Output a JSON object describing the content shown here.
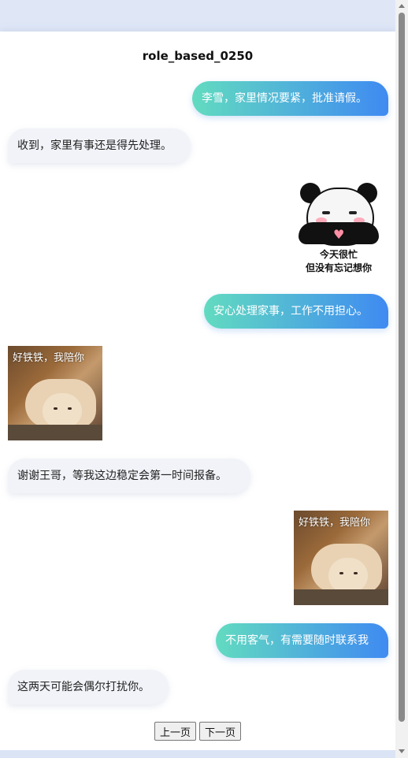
{
  "chat": {
    "title": "role_based_0250",
    "messages": [
      {
        "side": "right",
        "text": "李雪，家里情况要紧，批准请假。"
      },
      {
        "side": "left",
        "text": "收到，家里有事还是得先处理。"
      },
      {
        "side": "right",
        "sticker": "panda-heart-sticker",
        "line1": "今天很忙",
        "line2": "但没有忘记想你"
      },
      {
        "side": "right",
        "text": "安心处理家事，工作不用担心。"
      },
      {
        "side": "left",
        "sticker": "shiba-dog-sticker",
        "caption": "好铁铁，我陪你"
      },
      {
        "side": "left",
        "text": "谢谢王哥，等我这边稳定会第一时间报备。"
      },
      {
        "side": "right",
        "sticker": "shiba-dog-sticker",
        "caption": "好铁铁，我陪你"
      },
      {
        "side": "right",
        "text": "不用客气，有需要随时联系我"
      },
      {
        "side": "left",
        "text": "这两天可能会偶尔打扰你。"
      }
    ]
  },
  "pager": {
    "prev_label": "上一页",
    "next_label": "下一页"
  },
  "colors": {
    "right_bubble_start": "#62dbc0",
    "right_bubble_end": "#3f8af2",
    "left_bubble": "#f1f3f8",
    "header_band": "#dfe7f7"
  }
}
